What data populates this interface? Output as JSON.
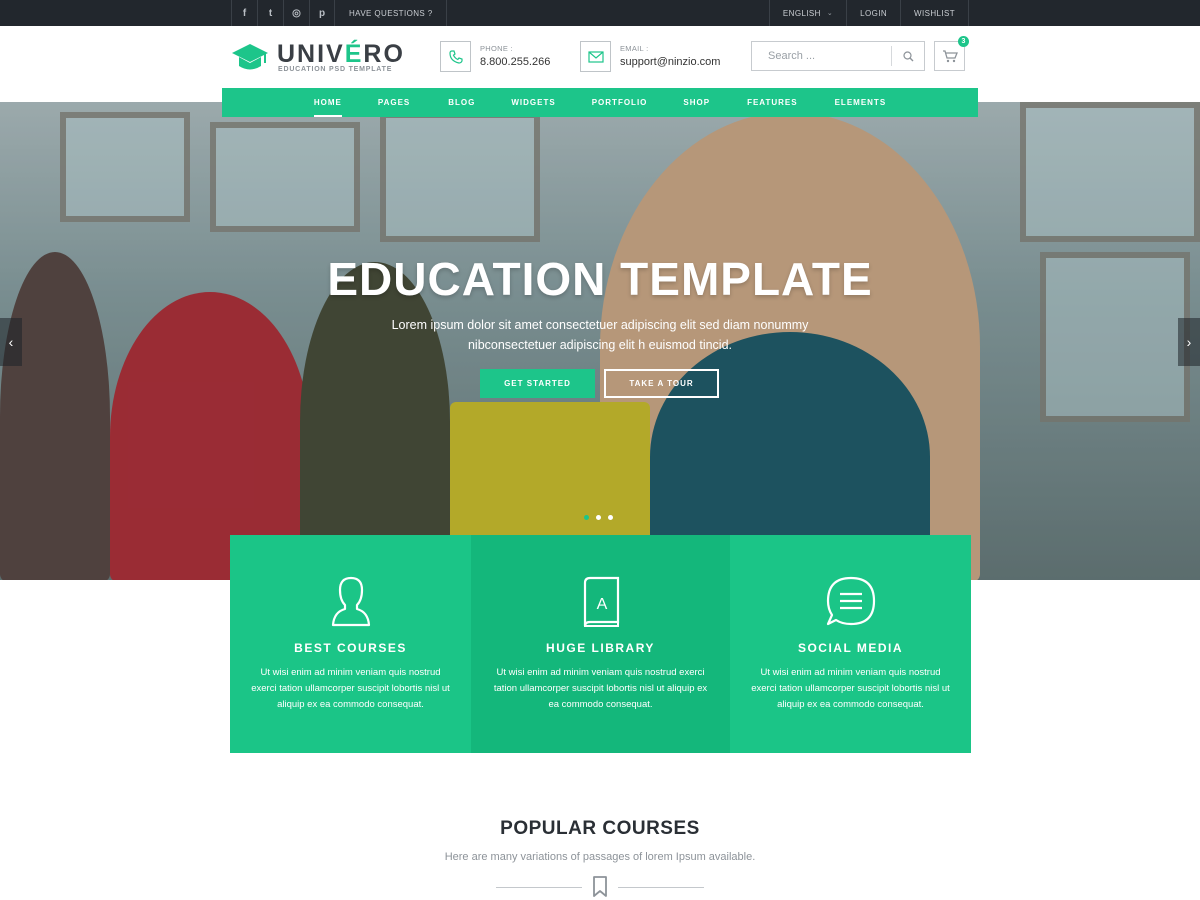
{
  "topbar": {
    "social_icons": [
      "facebook-icon",
      "twitter-icon",
      "instagram-icon",
      "pinterest-icon"
    ],
    "social_glyphs": [
      "f",
      "t",
      "◎",
      "p"
    ],
    "questions": "HAVE QUESTIONS ?",
    "language": "ENGLISH",
    "login": "LOGIN",
    "wishlist": "WISHLIST"
  },
  "header": {
    "logo_name_pre": "UNIV",
    "logo_name_accent": "É",
    "logo_name_post": "RO",
    "logo_tagline": "EDUCATION PSD TEMPLATE",
    "phone_label": "PHONE :",
    "phone_value": "8.800.255.266",
    "email_label": "EMAIL :",
    "email_value": "support@ninzio.com",
    "search_placeholder": "Search ...",
    "cart_count": "3"
  },
  "nav": {
    "items": [
      {
        "label": "HOME",
        "active": true
      },
      {
        "label": "PAGES",
        "active": false
      },
      {
        "label": "BLOG",
        "active": false
      },
      {
        "label": "WIDGETS",
        "active": false
      },
      {
        "label": "PORTFOLIO",
        "active": false
      },
      {
        "label": "SHOP",
        "active": false
      },
      {
        "label": "FEATURES",
        "active": false
      },
      {
        "label": "ELEMENTS",
        "active": false
      }
    ]
  },
  "hero": {
    "title": "EDUCATION TEMPLATE",
    "subtitle": "Lorem ipsum dolor sit amet consectetuer adipiscing elit sed diam nonummy nibconsectetuer adipiscing elit h euismod tincid.",
    "btn_primary": "GET STARTED",
    "btn_secondary": "TAKE A TOUR",
    "slide_count": 3,
    "active_slide": 1
  },
  "features": [
    {
      "icon": "user-icon",
      "title": "BEST COURSES",
      "text": "Ut wisi enim ad minim veniam quis nostrud exerci tation ullamcorper suscipit lobortis nisl ut aliquip ex ea commodo consequat.",
      "bg": "#1bc587"
    },
    {
      "icon": "book-icon",
      "title": "HUGE LIBRARY",
      "text": "Ut wisi enim ad minim veniam quis nostrud exerci tation ullamcorper suscipit lobortis nisl ut aliquip ex ea commodo consequat.",
      "bg": "#14b77b"
    },
    {
      "icon": "chat-icon",
      "title": "SOCIAL MEDIA",
      "text": "Ut wisi enim ad minim veniam quis nostrud exerci tation ullamcorper suscipit lobortis nisl ut aliquip ex ea commodo consequat.",
      "bg": "#1bc587"
    }
  ],
  "popular": {
    "title": "POPULAR COURSES",
    "description": "Here are many variations of passages of lorem Ipsum available."
  },
  "colors": {
    "accent": "#1dc58a",
    "topbar": "#22272d"
  }
}
